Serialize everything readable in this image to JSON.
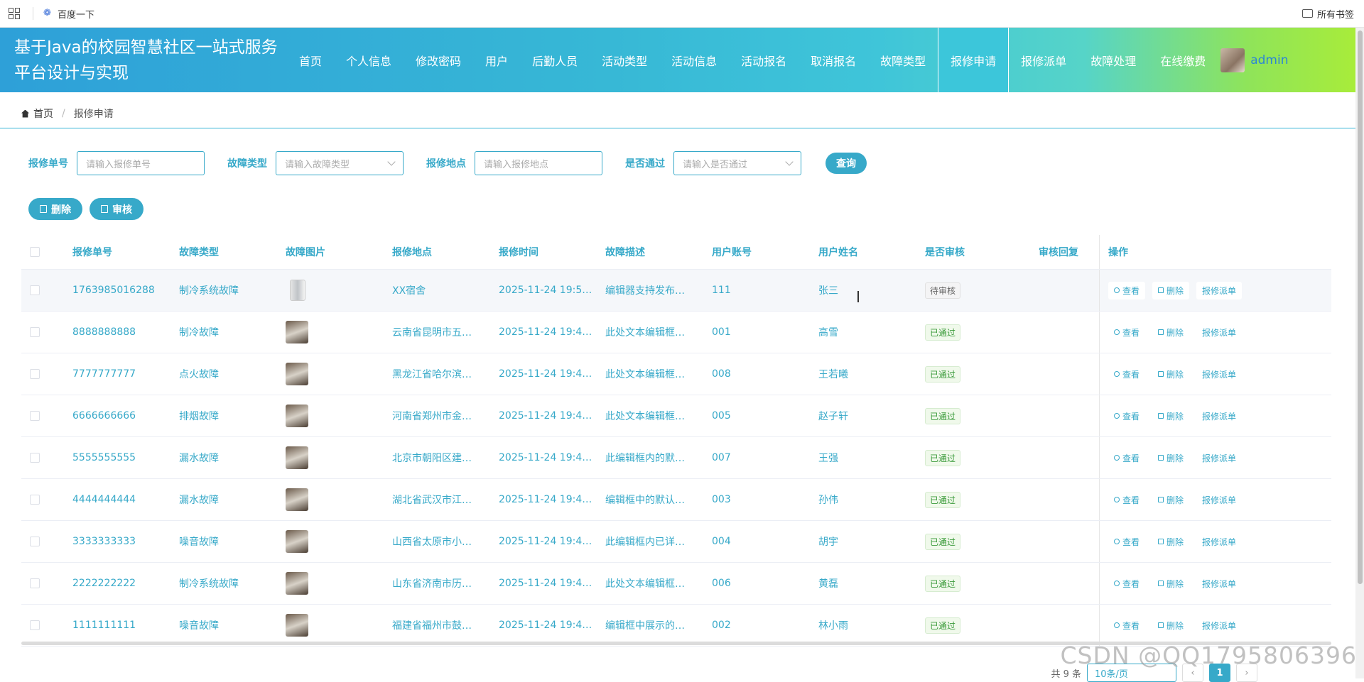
{
  "browser": {
    "bookmark": "百度一下",
    "all_bookmarks": "所有书签"
  },
  "header": {
    "title": "基于Java的校园智慧社区一站式服务平台设计与实现",
    "nav": [
      "首页",
      "个人信息",
      "修改密码",
      "用户",
      "后勤人员",
      "活动类型",
      "活动信息",
      "活动报名",
      "取消报名",
      "故障类型",
      "报修申请",
      "报修派单",
      "故障处理",
      "在线缴费"
    ],
    "active_nav": "报修申请",
    "username": "admin"
  },
  "breadcrumb": {
    "home": "首页",
    "current": "报修申请"
  },
  "search": {
    "order_label": "报修单号",
    "order_placeholder": "请输入报修单号",
    "type_label": "故障类型",
    "type_placeholder": "请输入故障类型",
    "location_label": "报修地点",
    "location_placeholder": "请输入报修地点",
    "approved_label": "是否通过",
    "approved_placeholder": "请输入是否通过",
    "query_button": "查询"
  },
  "actions": {
    "delete": "删除",
    "audit": "审核"
  },
  "table": {
    "headers": [
      "报修单号",
      "故障类型",
      "故障图片",
      "报修地点",
      "报修时间",
      "故障描述",
      "用户账号",
      "用户姓名",
      "是否审核",
      "审核回复",
      "操作"
    ],
    "op_view": "查看",
    "op_delete": "删除",
    "op_dispatch": "报修派单",
    "rows": [
      {
        "order": "1763985016288",
        "type": "制冷系统故障",
        "location": "XX宿舍",
        "time": "2025-11-24 19:50:…",
        "desc": "编辑器支持发布…",
        "account": "111",
        "name": "张三",
        "status": "待审核",
        "reply": ""
      },
      {
        "order": "8888888888",
        "type": "制冷故障",
        "location": "云南省昆明市五…",
        "time": "2025-11-24 19:46:…",
        "desc": "此处文本编辑框…",
        "account": "001",
        "name": "高雪",
        "status": "已通过",
        "reply": ""
      },
      {
        "order": "7777777777",
        "type": "点火故障",
        "location": "黑龙江省哈尔滨…",
        "time": "2025-11-24 19:46:…",
        "desc": "此处文本编辑框…",
        "account": "008",
        "name": "王若曦",
        "status": "已通过",
        "reply": ""
      },
      {
        "order": "6666666666",
        "type": "排烟故障",
        "location": "河南省郑州市金…",
        "time": "2025-11-24 19:46:…",
        "desc": "此处文本编辑框…",
        "account": "005",
        "name": "赵子轩",
        "status": "已通过",
        "reply": ""
      },
      {
        "order": "5555555555",
        "type": "漏水故障",
        "location": "北京市朝阳区建…",
        "time": "2025-11-24 19:46:…",
        "desc": "此编辑框内的默…",
        "account": "007",
        "name": "王强",
        "status": "已通过",
        "reply": ""
      },
      {
        "order": "4444444444",
        "type": "漏水故障",
        "location": "湖北省武汉市江…",
        "time": "2025-11-24 19:46:…",
        "desc": "编辑框中的默认…",
        "account": "003",
        "name": "孙伟",
        "status": "已通过",
        "reply": ""
      },
      {
        "order": "3333333333",
        "type": "噪音故障",
        "location": "山西省太原市小…",
        "time": "2025-11-24 19:46:…",
        "desc": "此编辑框内已详…",
        "account": "004",
        "name": "胡宇",
        "status": "已通过",
        "reply": ""
      },
      {
        "order": "2222222222",
        "type": "制冷系统故障",
        "location": "山东省济南市历…",
        "time": "2025-11-24 19:46:…",
        "desc": "此处文本编辑框…",
        "account": "006",
        "name": "黄磊",
        "status": "已通过",
        "reply": ""
      },
      {
        "order": "1111111111",
        "type": "噪音故障",
        "location": "福建省福州市鼓…",
        "time": "2025-11-24 19:46:…",
        "desc": "编辑框中展示的…",
        "account": "002",
        "name": "林小雨",
        "status": "已通过",
        "reply": ""
      }
    ]
  },
  "pager": {
    "total": "共 9 条",
    "page_size": "10条/页",
    "prev": "‹",
    "current": "1",
    "next": "›"
  },
  "watermark": "CSDN @QQ1795806396",
  "colors": {
    "accent": "#37a9c9",
    "success": "#3b9b3b"
  }
}
